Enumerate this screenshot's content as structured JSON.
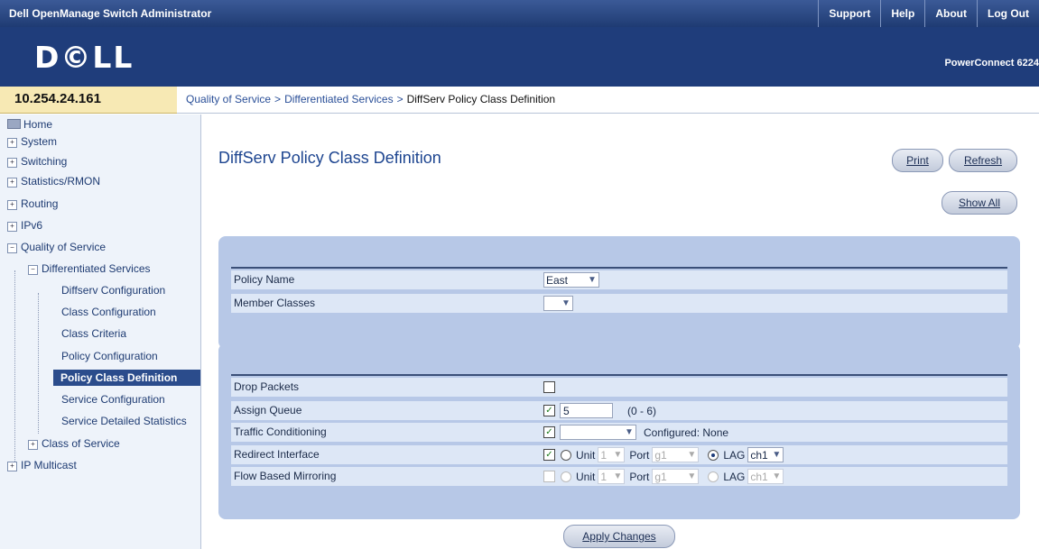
{
  "app": {
    "title": "Dell OpenManage Switch Administrator",
    "links": [
      "Support",
      "Help",
      "About",
      "Log Out"
    ],
    "logo": "D©LL",
    "product": "PowerConnect 6224"
  },
  "ip": "10.254.24.161",
  "breadcrumb": {
    "items": [
      "Quality of Service",
      "Differentiated Services"
    ],
    "separator": ">",
    "current": "DiffServ Policy Class Definition"
  },
  "sidebar": {
    "items": [
      {
        "label": "Home",
        "toggle": ""
      },
      {
        "label": "System",
        "toggle": "+"
      },
      {
        "label": "Switching",
        "toggle": "+"
      },
      {
        "label": "Statistics/RMON",
        "toggle": "+"
      },
      {
        "label": "Routing",
        "toggle": "+"
      },
      {
        "label": "IPv6",
        "toggle": "+"
      },
      {
        "label": "Quality of Service",
        "toggle": "−"
      },
      {
        "label": "Differentiated Services",
        "toggle": "−"
      },
      {
        "label": "Diffserv Configuration",
        "toggle": ""
      },
      {
        "label": "Class Configuration",
        "toggle": ""
      },
      {
        "label": "Class Criteria",
        "toggle": ""
      },
      {
        "label": "Policy Configuration",
        "toggle": ""
      },
      {
        "label": "Policy Class Definition",
        "toggle": ""
      },
      {
        "label": "Service Configuration",
        "toggle": ""
      },
      {
        "label": "Service Detailed Statistics",
        "toggle": ""
      },
      {
        "label": "Class of Service",
        "toggle": "+"
      },
      {
        "label": "IP Multicast",
        "toggle": "+"
      }
    ]
  },
  "page": {
    "title": "DiffServ Policy Class Definition",
    "print_label": "Print",
    "refresh_label": "Refresh",
    "show_all_label": "Show All",
    "apply_label": "Apply Changes"
  },
  "policy": {
    "policy_name_label": "Policy Name",
    "policy_name_value": "East",
    "member_classes_label": "Member Classes",
    "member_classes_value": ""
  },
  "settings": {
    "drop_packets_label": "Drop Packets",
    "drop_packets_checked": false,
    "assign_queue_label": "Assign Queue",
    "assign_queue_checked": true,
    "assign_queue_value": "5",
    "assign_queue_range": "(0 - 6)",
    "traffic_conditioning_label": "Traffic Conditioning",
    "traffic_conditioning_checked": true,
    "traffic_conditioning_value": "",
    "traffic_conditioning_status": "Configured: None",
    "redirect_label": "Redirect Interface",
    "redirect_checked": true,
    "redirect_unit_label": "Unit",
    "redirect_unit_value": "1",
    "redirect_port_label": "Port",
    "redirect_port_value": "g1",
    "redirect_lag_label": "LAG",
    "redirect_lag_value": "ch1",
    "redirect_selected": "LAG",
    "mirroring_label": "Flow Based Mirroring",
    "mirroring_checked": false,
    "mirroring_unit_label": "Unit",
    "mirroring_unit_value": "1",
    "mirroring_port_label": "Port",
    "mirroring_port_value": "g1",
    "mirroring_lag_label": "LAG",
    "mirroring_lag_value": "ch1"
  }
}
